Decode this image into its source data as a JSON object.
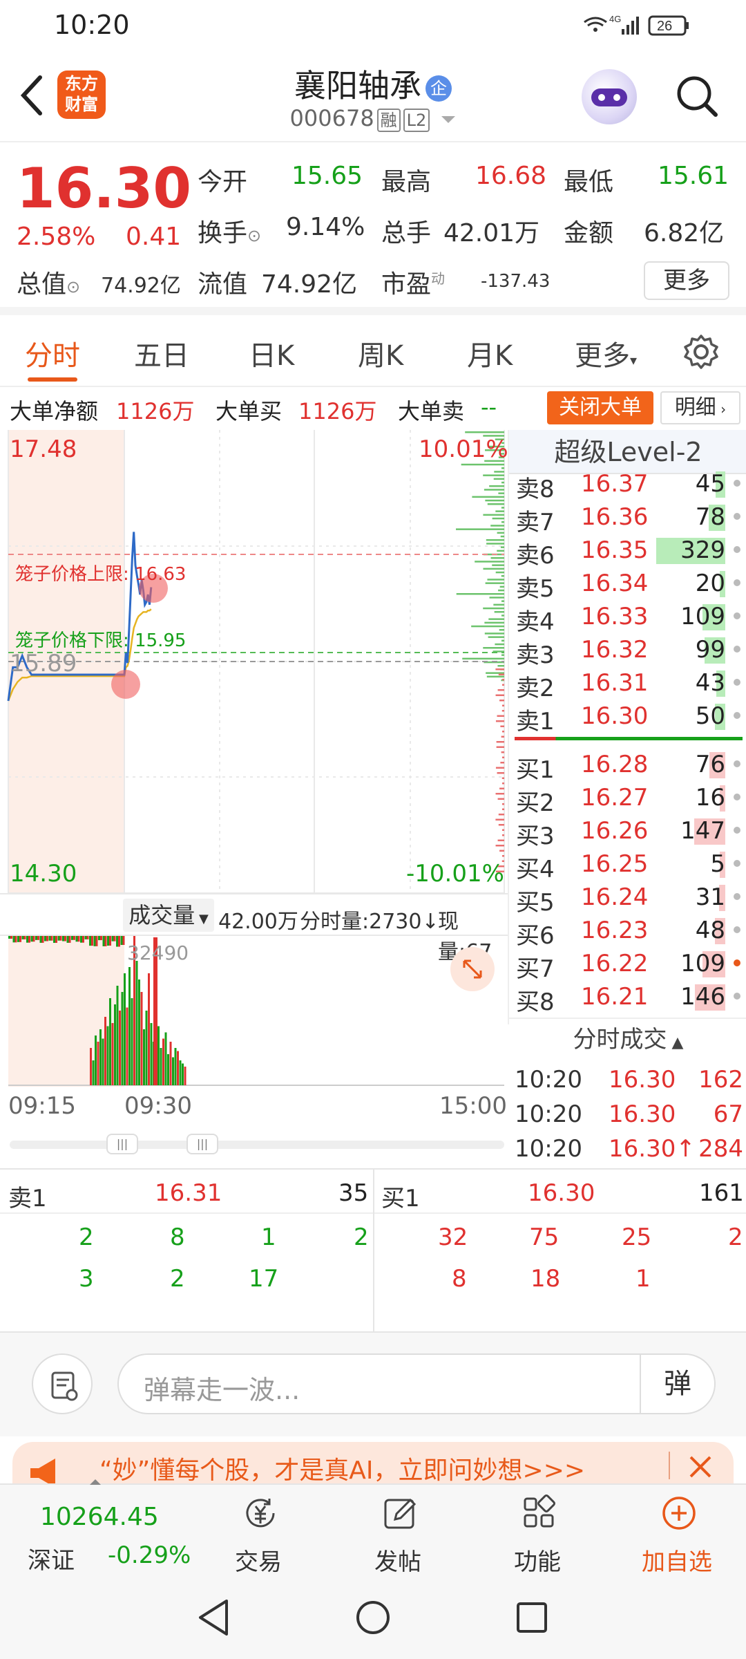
{
  "status_bar": {
    "time": "10:20",
    "network": "4G",
    "battery": "26"
  },
  "header": {
    "logo_line1": "东方",
    "logo_line2": "财富",
    "stock_name": "襄阳轴承",
    "badge": "企",
    "stock_code": "000678",
    "tag_margin": "融",
    "tag_level": "L2"
  },
  "quote": {
    "price": "16.30",
    "change_pct": "2.58%",
    "change": "0.41",
    "open_label": "今开",
    "open": "15.65",
    "high_label": "最高",
    "high": "16.68",
    "low_label": "最低",
    "low": "15.61",
    "turnover_label": "换手",
    "turnover": "9.14%",
    "volume_label": "总手",
    "volume": "42.01万",
    "amount_label": "金额",
    "amount": "6.82亿",
    "mktcap_label": "总值",
    "mktcap": "74.92亿",
    "float_label": "流值",
    "float": "74.92亿",
    "pe_label": "市盈",
    "pe_sup": "动",
    "pe": "-137.43",
    "more": "更多"
  },
  "tabs": [
    "分时",
    "五日",
    "日K",
    "周K",
    "月K",
    "更多"
  ],
  "big_order": {
    "net_label": "大单净额",
    "net": "1126万",
    "buy_label": "大单买",
    "buy": "1126万",
    "sell_label": "大单卖",
    "sell": "--",
    "close_btn": "关闭大单",
    "detail_btn": "明细"
  },
  "chart": {
    "upper_price": "17.48",
    "lower_price": "14.30",
    "upper_pct": "10.01%",
    "lower_pct": "-10.01%",
    "ref_price": "15.89",
    "cage_upper_label": "笼子价格上限: 16.63",
    "cage_lower_label": "笼子价格下限: 15.95"
  },
  "chart_data": {
    "type": "line",
    "ylim": [
      14.3,
      17.48
    ],
    "ref": 15.89,
    "series": [
      {
        "values": [
          15.62,
          15.85,
          15.85,
          15.93,
          15.85,
          15.8,
          15.8,
          15.8,
          15.8,
          15.8,
          15.8,
          15.8,
          15.8,
          15.8,
          15.8,
          15.8,
          15.8,
          15.8,
          15.8,
          15.8,
          15.8,
          15.8,
          15.8,
          15.8,
          15.8,
          15.8,
          15.95,
          15.88,
          16.1,
          16.35,
          16.6,
          16.78,
          16.55,
          16.48,
          16.42,
          16.35,
          16.45,
          16.38,
          16.28,
          16.3,
          16.35,
          16.28,
          16.4
        ]
      },
      {
        "values": [
          15.62,
          15.7,
          15.75,
          15.78,
          15.78,
          15.79,
          15.79,
          15.79,
          15.79,
          15.79,
          15.79,
          15.79,
          15.79,
          15.79,
          15.79,
          15.79,
          15.79,
          15.79,
          15.79,
          15.79,
          15.79,
          15.79,
          15.79,
          15.79,
          15.79,
          15.79,
          15.85,
          15.86,
          15.9,
          15.97,
          16.05,
          16.12,
          16.15,
          16.18,
          16.2,
          16.21,
          16.22,
          16.23,
          16.23,
          16.23,
          16.24,
          16.24,
          16.25
        ]
      }
    ]
  },
  "order_book": {
    "header": "超级Level-2",
    "asks": [
      {
        "label": "卖8",
        "price": "16.37",
        "vol": "45"
      },
      {
        "label": "卖7",
        "price": "16.36",
        "vol": "78"
      },
      {
        "label": "卖6",
        "price": "16.35",
        "vol": "329"
      },
      {
        "label": "卖5",
        "price": "16.34",
        "vol": "20"
      },
      {
        "label": "卖4",
        "price": "16.33",
        "vol": "109"
      },
      {
        "label": "卖3",
        "price": "16.32",
        "vol": "99"
      },
      {
        "label": "卖2",
        "price": "16.31",
        "vol": "43"
      },
      {
        "label": "卖1",
        "price": "16.30",
        "vol": "50"
      }
    ],
    "bids": [
      {
        "label": "买1",
        "price": "16.28",
        "vol": "76"
      },
      {
        "label": "买2",
        "price": "16.27",
        "vol": "16"
      },
      {
        "label": "买3",
        "price": "16.26",
        "vol": "147"
      },
      {
        "label": "买4",
        "price": "16.25",
        "vol": "5"
      },
      {
        "label": "买5",
        "price": "16.24",
        "vol": "31"
      },
      {
        "label": "买6",
        "price": "16.23",
        "vol": "48"
      },
      {
        "label": "买7",
        "price": "16.22",
        "vol": "109"
      },
      {
        "label": "买8",
        "price": "16.21",
        "vol": "146"
      }
    ],
    "tick_header": "分时成交",
    "ticks": [
      {
        "time": "10:20",
        "price": "16.30",
        "vol": "162"
      },
      {
        "time": "10:20",
        "price": "16.30",
        "vol": "67"
      },
      {
        "time": "10:20",
        "price": "16.30↑",
        "vol": "284"
      }
    ]
  },
  "volume_toolbar": {
    "select": "成交量",
    "total": "42.00万",
    "minute": "分时量:2730↓",
    "now": "现量:67"
  },
  "volume_chart": {
    "peak_label": "32490"
  },
  "time_axis": {
    "start": "09:15",
    "mid": "09:30",
    "end": "15:00"
  },
  "bottom_book": {
    "sell_label": "卖1",
    "sell_price": "16.31",
    "sell_vol": "35",
    "sell_row1": [
      "2",
      "8",
      "1",
      "2"
    ],
    "sell_row2": [
      "3",
      "2",
      "17"
    ],
    "buy_label": "买1",
    "buy_price": "16.30",
    "buy_vol": "161",
    "buy_row1": [
      "32",
      "75",
      "25",
      "2"
    ],
    "buy_row2": [
      "8",
      "18",
      "1"
    ]
  },
  "comment": {
    "placeholder": "弹幕走一波...",
    "dan": "弹"
  },
  "banner": {
    "text": "“妙”懂每个股，才是真AI，立即问妙想>>>"
  },
  "bottom_nav": {
    "index_value": "10264.45",
    "index_name": "深证",
    "index_change": "-0.29%",
    "items": [
      "交易",
      "发帖",
      "功能",
      "加自选"
    ]
  }
}
